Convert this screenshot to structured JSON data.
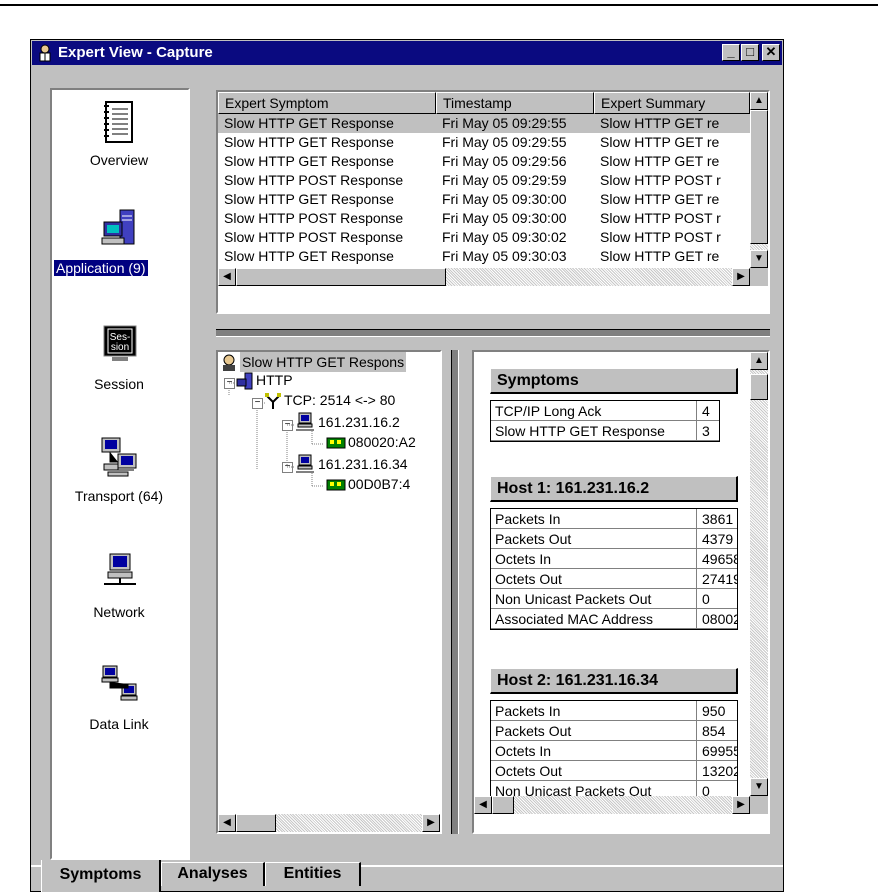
{
  "window": {
    "title": "Expert View - Capture",
    "minimize": "_",
    "maximize": "□",
    "close": "✕"
  },
  "nav": [
    {
      "label": "Overview",
      "icon": "notebook-icon"
    },
    {
      "label": "Application (9)",
      "icon": "server-computer-icon",
      "selected": true
    },
    {
      "label": "Session",
      "icon": "session-monitor-icon"
    },
    {
      "label": "Transport (64)",
      "icon": "networked-computers-icon"
    },
    {
      "label": "Network",
      "icon": "network-computer-icon"
    },
    {
      "label": "Data Link",
      "icon": "data-link-computers-icon"
    }
  ],
  "session_icon_text": "Ses-\nsion",
  "symptom_table": {
    "columns": [
      "Expert Symptom",
      "Timestamp",
      "Expert Summary"
    ],
    "rows": [
      [
        "Slow HTTP GET Response",
        "Fri May 05 09:29:55",
        "Slow HTTP GET re"
      ],
      [
        "Slow HTTP GET Response",
        "Fri May 05 09:29:55",
        "Slow HTTP GET re"
      ],
      [
        "Slow HTTP GET Response",
        "Fri May 05 09:29:56",
        "Slow HTTP GET re"
      ],
      [
        "Slow HTTP POST Response",
        "Fri May 05 09:29:59",
        "Slow HTTP POST r"
      ],
      [
        "Slow HTTP GET Response",
        "Fri May 05 09:30:00",
        "Slow HTTP GET re"
      ],
      [
        "Slow HTTP POST Response",
        "Fri May 05 09:30:00",
        "Slow HTTP POST r"
      ],
      [
        "Slow HTTP POST Response",
        "Fri May 05 09:30:02",
        "Slow HTTP POST r"
      ],
      [
        "Slow HTTP GET Response",
        "Fri May 05 09:30:03",
        "Slow HTTP GET re"
      ]
    ]
  },
  "tree": {
    "root": "Slow HTTP GET Respons",
    "http": "HTTP",
    "tcp": "TCP: 2514 <-> 80",
    "host1": "161.231.16.2",
    "mac1": "080020:A2",
    "host2": "161.231.16.34",
    "mac2": "00D0B7:4"
  },
  "details": {
    "symptoms_title": "Symptoms",
    "symptoms": [
      [
        "TCP/IP Long Ack",
        "4"
      ],
      [
        "Slow HTTP GET Response",
        "3"
      ]
    ],
    "host1_title": "Host 1: 161.231.16.2",
    "host1": [
      [
        "Packets In",
        "3861"
      ],
      [
        "Packets Out",
        "4379"
      ],
      [
        "Octets In",
        "49658"
      ],
      [
        "Octets Out",
        "27419"
      ],
      [
        "Non Unicast Packets Out",
        "0"
      ],
      [
        "Associated MAC Address",
        "08002"
      ]
    ],
    "host2_title": "Host 2: 161.231.16.34",
    "host2": [
      [
        "Packets In",
        "950"
      ],
      [
        "Packets Out",
        "854"
      ],
      [
        "Octets In",
        "69955"
      ],
      [
        "Octets Out",
        "13202"
      ],
      [
        "Non Unicast Packets Out",
        "0"
      ]
    ]
  },
  "tabs": [
    "Symptoms",
    "Analyses",
    "Entities"
  ],
  "scroll": {
    "up": "▲",
    "down": "▼",
    "left": "◀",
    "right": "▶"
  }
}
